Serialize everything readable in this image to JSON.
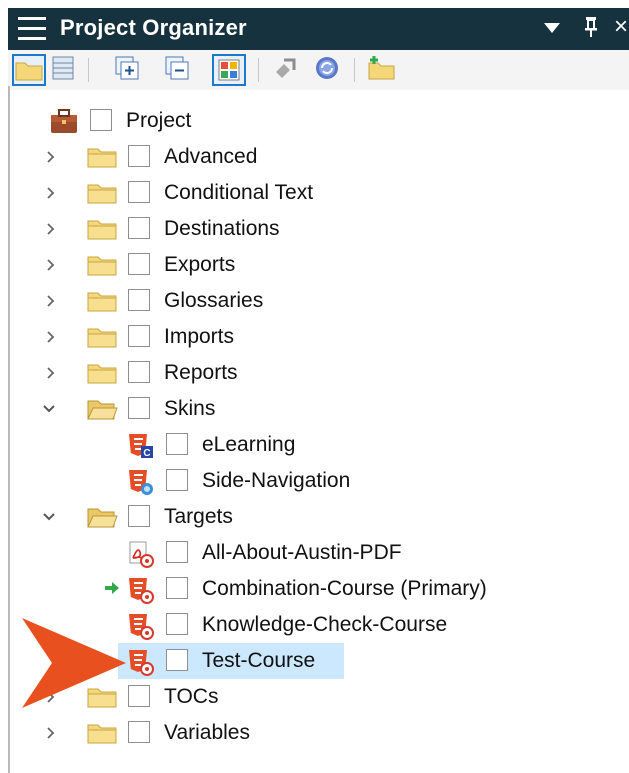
{
  "window": {
    "title": "Project Organizer",
    "dropdown_icon": "dropdown-arrow-icon",
    "pin_icon": "pin-icon",
    "close_label": "×"
  },
  "toolbar": {
    "buttons": [
      {
        "name": "open-folder-button",
        "icon": "folder-icon",
        "active": true
      },
      {
        "name": "table-view-button",
        "icon": "table-icon",
        "active": false
      },
      {
        "name": "expand-all-button",
        "icon": "expand-icon",
        "active": false
      },
      {
        "name": "collapse-all-button",
        "icon": "collapse-icon",
        "active": false
      },
      {
        "name": "color-view-button",
        "icon": "grid-color-icon",
        "active": true
      },
      {
        "name": "bind-button",
        "icon": "bind-icon",
        "active": false
      },
      {
        "name": "sync-button",
        "icon": "sync-icon",
        "active": false
      },
      {
        "name": "new-folder-button",
        "icon": "new-folder-icon",
        "active": false
      }
    ]
  },
  "tree": {
    "root": {
      "label": "Project",
      "icon": "briefcase-icon"
    },
    "items": [
      {
        "label": "Advanced",
        "type": "folder",
        "expanded": false
      },
      {
        "label": "Conditional Text",
        "type": "folder",
        "expanded": false
      },
      {
        "label": "Destinations",
        "type": "folder",
        "expanded": false
      },
      {
        "label": "Exports",
        "type": "folder",
        "expanded": false
      },
      {
        "label": "Glossaries",
        "type": "folder",
        "expanded": false
      },
      {
        "label": "Imports",
        "type": "folder",
        "expanded": false
      },
      {
        "label": "Reports",
        "type": "folder",
        "expanded": false
      },
      {
        "label": "Skins",
        "type": "folder",
        "expanded": true
      },
      {
        "label": "eLearning",
        "type": "skin",
        "badge": "C"
      },
      {
        "label": "Side-Navigation",
        "type": "skin",
        "badge": "nav"
      },
      {
        "label": "Targets",
        "type": "folder",
        "expanded": true
      },
      {
        "label": "All-About-Austin-PDF",
        "type": "target-pdf"
      },
      {
        "label": "Combination-Course (Primary)",
        "type": "target-html5",
        "primary": true
      },
      {
        "label": "Knowledge-Check-Course",
        "type": "target-html5"
      },
      {
        "label": "Test-Course",
        "type": "target-html5",
        "selected": true
      },
      {
        "label": "TOCs",
        "type": "folder",
        "expanded": false
      },
      {
        "label": "Variables",
        "type": "folder",
        "expanded": false
      }
    ]
  },
  "colors": {
    "titlebar": "#17323f",
    "selection": "#cce8ff",
    "pointer": "#e8501f",
    "folder": "#f5d77a",
    "html5": "#e44d26"
  }
}
